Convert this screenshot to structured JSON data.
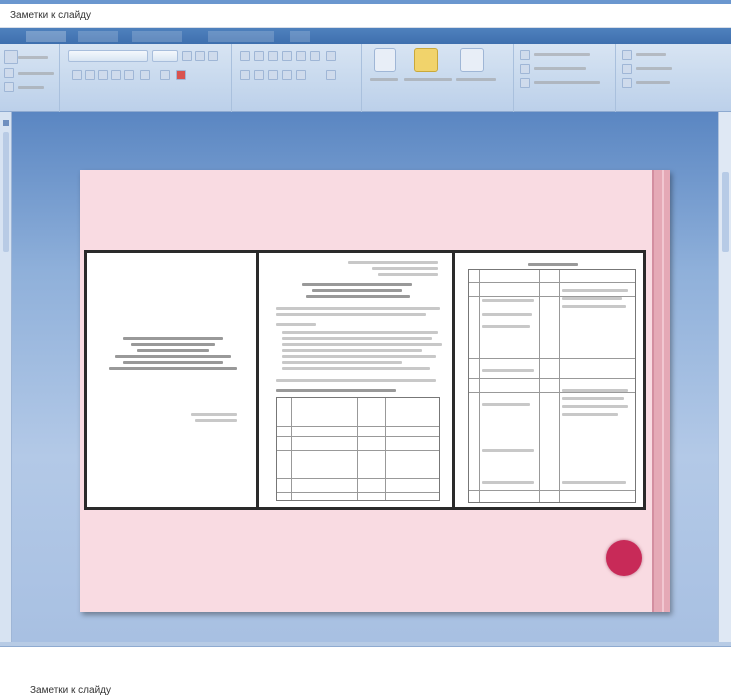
{
  "window": {
    "title": "Заметки к слайду"
  },
  "ribbon": {
    "colors": {
      "accent": "#4f81bd",
      "ribbon_bg": "#c9daee"
    }
  },
  "slide": {
    "colors": {
      "background": "#f9dbe2",
      "accent_circle": "#c82a58",
      "edge": "#e5a9b6"
    }
  },
  "notes": {
    "label": "Заметки к слайду"
  }
}
